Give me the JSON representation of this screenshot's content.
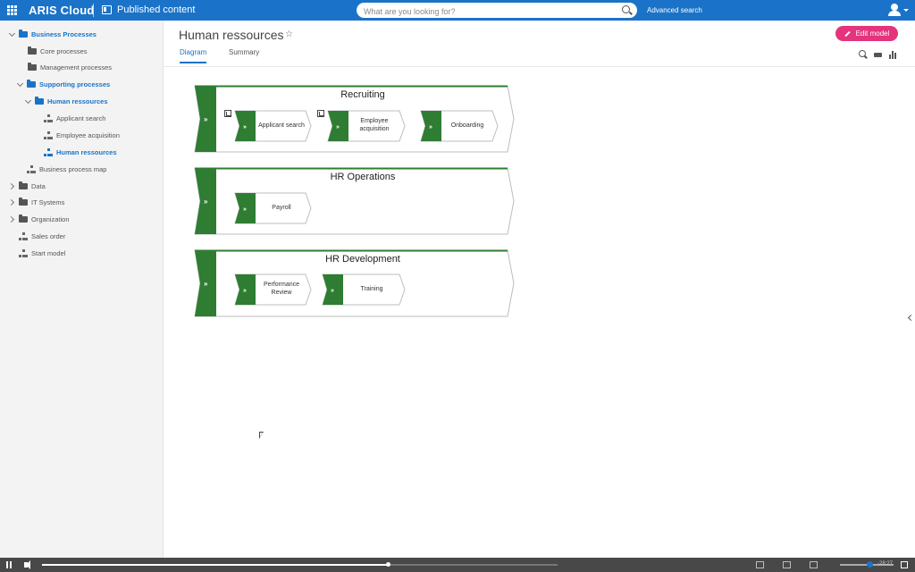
{
  "topbar": {
    "brand": "ARIS Cloud",
    "section": "Published content",
    "search_placeholder": "What are you looking for?",
    "advanced_search": "Advanced search"
  },
  "sidebar": {
    "items": [
      {
        "label": "Business Processes"
      },
      {
        "label": "Core processes"
      },
      {
        "label": "Management processes"
      },
      {
        "label": "Supporting processes"
      },
      {
        "label": "Human ressources"
      },
      {
        "label": "Applicant search"
      },
      {
        "label": "Employee acquisition"
      },
      {
        "label": "Human ressources"
      },
      {
        "label": "Business process map"
      },
      {
        "label": "Data"
      },
      {
        "label": "IT Systems"
      },
      {
        "label": "Organization"
      },
      {
        "label": "Sales order"
      },
      {
        "label": "Start model"
      }
    ]
  },
  "header": {
    "title": "Human ressources",
    "star": "☆",
    "tabs": [
      {
        "label": "Diagram"
      },
      {
        "label": "Summary"
      }
    ],
    "edit_button": "Edit model"
  },
  "diagram": {
    "lanes": [
      {
        "title": "Recruiting",
        "processes": [
          "Applicant search",
          "Employee acquisition",
          "Onboarding"
        ]
      },
      {
        "title": "HR Operations",
        "processes": [
          "Payroll"
        ]
      },
      {
        "title": "HR Development",
        "processes": [
          "Performance Review",
          "Training"
        ]
      }
    ]
  },
  "video": {
    "time": "-28:27",
    "progress": 0.67
  },
  "colors": {
    "brand_blue": "#1a73c8",
    "accent_pink": "#e5337c",
    "process_green": "#2e7d32"
  }
}
